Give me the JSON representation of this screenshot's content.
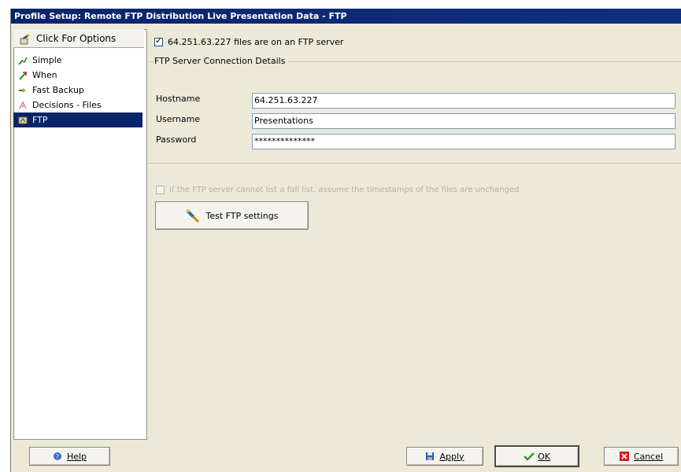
{
  "window": {
    "title": "Profile Setup: Remote FTP Distribution Live Presentation Data - FTP"
  },
  "sidebar": {
    "options_label": "Click For Options",
    "items": [
      {
        "label": "Simple",
        "icon": "simple-icon"
      },
      {
        "label": "When",
        "icon": "when-icon"
      },
      {
        "label": "Fast Backup",
        "icon": "fast-backup-icon"
      },
      {
        "label": "Decisions - Files",
        "icon": "decisions-icon"
      },
      {
        "label": "FTP",
        "icon": "ftp-icon",
        "selected": true
      }
    ]
  },
  "main": {
    "ftp_checkbox_label": "64.251.63.227 files are on an FTP server",
    "ftp_checkbox_checked": true,
    "group_title": "FTP Server Connection Details",
    "hostname_label": "Hostname",
    "hostname_value": "64.251.63.227",
    "username_label": "Username",
    "username_value": "Presentations",
    "password_label": "Password",
    "password_value": "**************",
    "disabled_option_label": "If the FTP server cannot list a full list, assume the timestamps of the files are unchanged",
    "disabled_option_checked": false,
    "test_button_label": "Test FTP settings"
  },
  "footer": {
    "help_label": "Help",
    "apply_label": "Apply",
    "ok_label": "OK",
    "cancel_label": "Cancel"
  },
  "colors": {
    "titlebar": "#0a246a",
    "selection": "#0a246a",
    "window_bg": "#ece9d8"
  }
}
